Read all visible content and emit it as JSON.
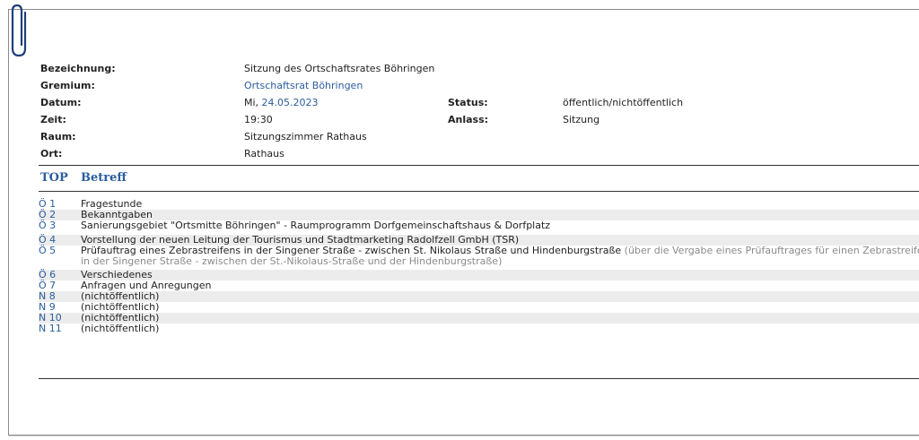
{
  "meta": {
    "bezeichnung_label": "Bezeichnung:",
    "bezeichnung_value": "Sitzung des Ortschaftsrates Böhringen",
    "gremium_label": "Gremium:",
    "gremium_value": "Ortschaftsrat Böhringen",
    "datum_label": "Datum:",
    "datum_prefix": "Mi,",
    "datum_value": "24.05.2023",
    "status_label": "Status:",
    "status_value": "öffentlich/nichtöffentlich",
    "zeit_label": "Zeit:",
    "zeit_value": "19:30",
    "anlass_label": "Anlass:",
    "anlass_value": "Sitzung",
    "raum_label": "Raum:",
    "raum_value": "Sitzungszimmer Rathaus",
    "ort_label": "Ort:",
    "ort_value": "Rathaus"
  },
  "agenda": {
    "col_top": "TOP",
    "col_betreff": "Betreff",
    "items": [
      {
        "num": "Ö 1",
        "text": "Fragestunde"
      },
      {
        "num": "Ö 2",
        "text": "Bekanntgaben"
      },
      {
        "num": "Ö 3",
        "text": "Sanierungsgebiet \"Ortsmitte Böhringen\" - Raumprogramm Dorfgemeinschaftshaus & Dorfplatz"
      },
      {
        "num": "Ö 4",
        "text": "Vorstellung der neuen Leitung der Tourismus und Stadtmarketing Radolfzell GmbH (TSR)"
      },
      {
        "num": "Ö 5",
        "text": "Prüfauftrag eines Zebrastreifens in der Singener Straße - zwischen St. Nikolaus Straße und Hindenburgstraße",
        "note": "(über die Vergabe eines Prüfauftrages für einen Zebrastreifen",
        "note_cont": "in der Singener Straße - zwischen der St.-Nikolaus-Straße und der Hindenburgstraße)"
      },
      {
        "num": "Ö 6",
        "text": "Verschiedenes"
      },
      {
        "num": "Ö 7",
        "text": "Anfragen und Anregungen"
      },
      {
        "num": "N 8",
        "text": "(nichtöffentlich)"
      },
      {
        "num": "N 9",
        "text": "(nichtöffentlich)"
      },
      {
        "num": "N 10",
        "text": "(nichtöffentlich)"
      },
      {
        "num": "N 11",
        "text": "(nichtöffentlich)"
      }
    ]
  },
  "colors": {
    "link": "#2b5d9e",
    "alt_row": "#ececec",
    "note": "#8a8a8a"
  },
  "icons": {
    "clip": "paperclip-icon"
  }
}
